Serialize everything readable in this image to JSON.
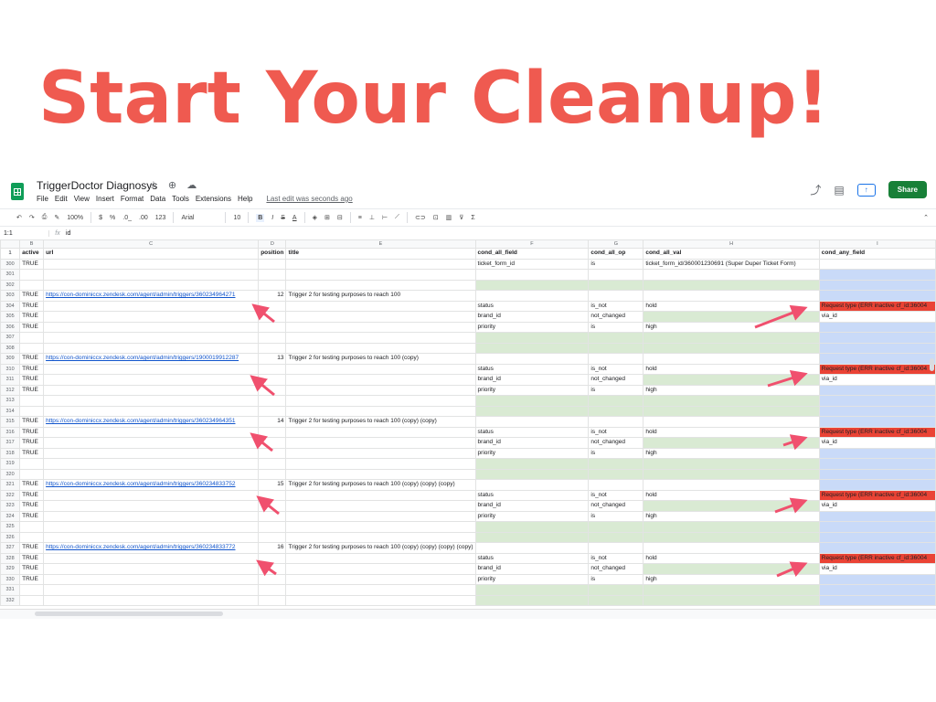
{
  "headline": "Start Your Cleanup!",
  "app": {
    "doc_title": "TriggerDoctor Diagnosys",
    "title_icons": "☆ ⊕ ☁",
    "menu": [
      "File",
      "Edit",
      "View",
      "Insert",
      "Format",
      "Data",
      "Tools",
      "Extensions",
      "Help"
    ],
    "last_edit": "Last edit was seconds ago",
    "share_label": "Share",
    "toolbar": {
      "zoom": "100%",
      "currency": "$",
      "percent": "%",
      "dec_minus": ".0_",
      "dec_plus": ".00",
      "format_num": "123",
      "font": "Arial",
      "font_size": "10",
      "bold": "B",
      "italic": "I",
      "strike": "S",
      "text_color": "A"
    },
    "formula_bar": {
      "cell_ref": "1:1",
      "fx": "fx",
      "content": "id"
    },
    "col_letters": [
      "",
      "B",
      "C",
      "D",
      "E",
      "F",
      "G",
      "H",
      "I"
    ],
    "header_row": {
      "rn": "1",
      "active": "active",
      "url": "url",
      "position": "position",
      "title": "title",
      "f": "cond_all_field",
      "op": "cond_all_op",
      "val": "cond_all_val",
      "any": "cond_any_field"
    },
    "rows": [
      {
        "rn": "300",
        "active": "TRUE",
        "url": "",
        "pos": "",
        "title": "",
        "f": "ticket_form_id",
        "op": "is",
        "val": "ticket_form_id/360001230691 (Super Duper Ticket Form)",
        "any": "",
        "k": "plain"
      },
      {
        "rn": "301",
        "active": "",
        "url": "",
        "pos": "",
        "title": "",
        "f": "",
        "op": "",
        "val": "",
        "any": "",
        "k": "plain"
      },
      {
        "rn": "302",
        "active": "",
        "url": "",
        "pos": "",
        "title": "",
        "f": "",
        "op": "",
        "val": "",
        "any": "",
        "k": "green"
      },
      {
        "rn": "303",
        "active": "TRUE",
        "url": "https://con-dominiccx.zendesk.com/agent/admin/triggers/360234964271",
        "pos": "12",
        "title": "Trigger 2 for testing purposes to reach 100",
        "f": "",
        "op": "",
        "val": "",
        "any": "",
        "k": "trigger"
      },
      {
        "rn": "304",
        "active": "TRUE",
        "url": "",
        "pos": "",
        "title": "",
        "f": "status",
        "op": "is_not",
        "val": "hold",
        "any": "Request type (ERR inactive cf_id:36004",
        "k": "status"
      },
      {
        "rn": "305",
        "active": "TRUE",
        "url": "",
        "pos": "",
        "title": "",
        "f": "brand_id",
        "op": "not_changed",
        "val": "",
        "any": "via_id",
        "k": "brand"
      },
      {
        "rn": "306",
        "active": "TRUE",
        "url": "",
        "pos": "",
        "title": "",
        "f": "priority",
        "op": "is",
        "val": "high",
        "any": "",
        "k": "prio"
      },
      {
        "rn": "307",
        "active": "",
        "url": "",
        "pos": "",
        "title": "",
        "f": "",
        "op": "",
        "val": "",
        "any": "",
        "k": "green"
      },
      {
        "rn": "308",
        "active": "",
        "url": "",
        "pos": "",
        "title": "",
        "f": "",
        "op": "",
        "val": "",
        "any": "",
        "k": "green"
      },
      {
        "rn": "309",
        "active": "TRUE",
        "url": "https://con-dominiccx.zendesk.com/agent/admin/triggers/1900019912287",
        "pos": "13",
        "title": "Trigger 2 for testing purposes to reach 100 (copy)",
        "f": "",
        "op": "",
        "val": "",
        "any": "",
        "k": "trigger"
      },
      {
        "rn": "310",
        "active": "TRUE",
        "url": "",
        "pos": "",
        "title": "",
        "f": "status",
        "op": "is_not",
        "val": "hold",
        "any": "Request type (ERR inactive cf_id:36004",
        "k": "status"
      },
      {
        "rn": "311",
        "active": "TRUE",
        "url": "",
        "pos": "",
        "title": "",
        "f": "brand_id",
        "op": "not_changed",
        "val": "",
        "any": "via_id",
        "k": "brand"
      },
      {
        "rn": "312",
        "active": "TRUE",
        "url": "",
        "pos": "",
        "title": "",
        "f": "priority",
        "op": "is",
        "val": "high",
        "any": "",
        "k": "prio"
      },
      {
        "rn": "313",
        "active": "",
        "url": "",
        "pos": "",
        "title": "",
        "f": "",
        "op": "",
        "val": "",
        "any": "",
        "k": "green"
      },
      {
        "rn": "314",
        "active": "",
        "url": "",
        "pos": "",
        "title": "",
        "f": "",
        "op": "",
        "val": "",
        "any": "",
        "k": "green"
      },
      {
        "rn": "315",
        "active": "TRUE",
        "url": "https://con-dominiccx.zendesk.com/agent/admin/triggers/360234964351",
        "pos": "14",
        "title": "Trigger 2 for testing purposes to reach 100 (copy)  (copy)",
        "f": "",
        "op": "",
        "val": "",
        "any": "",
        "k": "trigger"
      },
      {
        "rn": "316",
        "active": "TRUE",
        "url": "",
        "pos": "",
        "title": "",
        "f": "status",
        "op": "is_not",
        "val": "hold",
        "any": "Request type (ERR inactive cf_id:36004",
        "k": "status"
      },
      {
        "rn": "317",
        "active": "TRUE",
        "url": "",
        "pos": "",
        "title": "",
        "f": "brand_id",
        "op": "not_changed",
        "val": "",
        "any": "via_id",
        "k": "brand"
      },
      {
        "rn": "318",
        "active": "TRUE",
        "url": "",
        "pos": "",
        "title": "",
        "f": "priority",
        "op": "is",
        "val": "high",
        "any": "",
        "k": "prio"
      },
      {
        "rn": "319",
        "active": "",
        "url": "",
        "pos": "",
        "title": "",
        "f": "",
        "op": "",
        "val": "",
        "any": "",
        "k": "green"
      },
      {
        "rn": "320",
        "active": "",
        "url": "",
        "pos": "",
        "title": "",
        "f": "",
        "op": "",
        "val": "",
        "any": "",
        "k": "green"
      },
      {
        "rn": "321",
        "active": "TRUE",
        "url": "https://con-dominiccx.zendesk.com/agent/admin/triggers/360234833752",
        "pos": "15",
        "title": "Trigger 2 for testing purposes to reach 100 (copy)  (copy)  (copy)",
        "f": "",
        "op": "",
        "val": "",
        "any": "",
        "k": "trigger"
      },
      {
        "rn": "322",
        "active": "TRUE",
        "url": "",
        "pos": "",
        "title": "",
        "f": "status",
        "op": "is_not",
        "val": "hold",
        "any": "Request type (ERR inactive cf_id:36004",
        "k": "status"
      },
      {
        "rn": "323",
        "active": "TRUE",
        "url": "",
        "pos": "",
        "title": "",
        "f": "brand_id",
        "op": "not_changed",
        "val": "",
        "any": "via_id",
        "k": "brand"
      },
      {
        "rn": "324",
        "active": "TRUE",
        "url": "",
        "pos": "",
        "title": "",
        "f": "priority",
        "op": "is",
        "val": "high",
        "any": "",
        "k": "prio"
      },
      {
        "rn": "325",
        "active": "",
        "url": "",
        "pos": "",
        "title": "",
        "f": "",
        "op": "",
        "val": "",
        "any": "",
        "k": "green"
      },
      {
        "rn": "326",
        "active": "",
        "url": "",
        "pos": "",
        "title": "",
        "f": "",
        "op": "",
        "val": "",
        "any": "",
        "k": "green"
      },
      {
        "rn": "327",
        "active": "TRUE",
        "url": "https://con-dominiccx.zendesk.com/agent/admin/triggers/360234833772",
        "pos": "16",
        "title": "Trigger 2 for testing purposes to reach 100 (copy)  (copy)  (copy)  (copy)",
        "f": "",
        "op": "",
        "val": "",
        "any": "",
        "k": "trigger"
      },
      {
        "rn": "328",
        "active": "TRUE",
        "url": "",
        "pos": "",
        "title": "",
        "f": "status",
        "op": "is_not",
        "val": "hold",
        "any": "Request type (ERR inactive cf_id:36004",
        "k": "status"
      },
      {
        "rn": "329",
        "active": "TRUE",
        "url": "",
        "pos": "",
        "title": "",
        "f": "brand_id",
        "op": "not_changed",
        "val": "",
        "any": "via_id",
        "k": "brand"
      },
      {
        "rn": "330",
        "active": "TRUE",
        "url": "",
        "pos": "",
        "title": "",
        "f": "priority",
        "op": "is",
        "val": "high",
        "any": "",
        "k": "prio"
      },
      {
        "rn": "331",
        "active": "",
        "url": "",
        "pos": "",
        "title": "",
        "f": "",
        "op": "",
        "val": "",
        "any": "",
        "k": "green"
      },
      {
        "rn": "332",
        "active": "",
        "url": "",
        "pos": "",
        "title": "",
        "f": "",
        "op": "",
        "val": "",
        "any": "",
        "k": "green"
      }
    ]
  },
  "colors": {
    "headline": "#ef5a50",
    "green": "#d9ead3",
    "blue": "#c9daf8",
    "red": "#ea4335",
    "arrow": "#f0506e",
    "share": "#188038"
  }
}
